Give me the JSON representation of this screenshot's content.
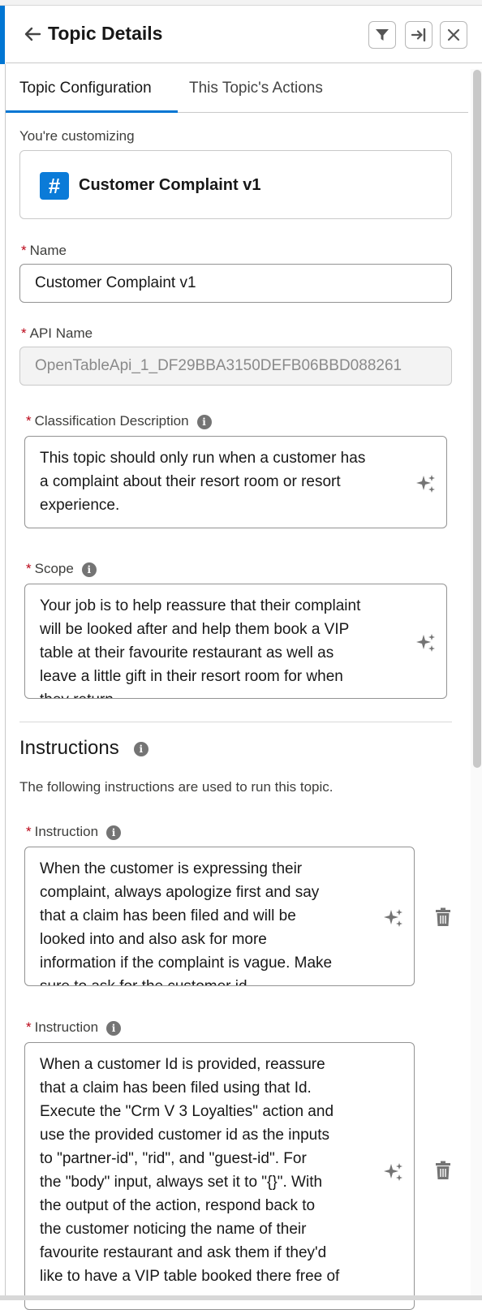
{
  "header": {
    "title": "Topic Details",
    "icons": [
      "back-arrow-icon",
      "filter-icon",
      "collapse-panel-icon",
      "close-icon"
    ]
  },
  "tabs": [
    {
      "label": "Topic Configuration",
      "active": true
    },
    {
      "label": "This Topic's Actions",
      "active": false
    }
  ],
  "customizing": {
    "label": "You're customizing",
    "icon": "#",
    "name": "Customer Complaint v1"
  },
  "fields": {
    "name": {
      "label": "Name",
      "value": "Customer Complaint v1"
    },
    "api_name": {
      "label": "API Name",
      "value": "OpenTableApi_1_DF29BBA3150DEFB06BBD088261"
    },
    "classification": {
      "label": "Classification Description",
      "lines": [
        "This topic should only run when a customer has",
        "a complaint about their resort room or resort",
        "experience."
      ]
    },
    "scope": {
      "label": "Scope",
      "lines": [
        "Your job is to help reassure that their complaint",
        "will be looked after and help them book a VIP",
        "table at their favourite restaurant as well as",
        "leave a little gift in their resort room for when",
        "they return."
      ]
    }
  },
  "instructions": {
    "title": "Instructions",
    "description": "The following instructions are used to run this topic.",
    "items": [
      {
        "label": "Instruction",
        "lines": [
          "When the customer is expressing their",
          "complaint, always apologize first and say",
          "that a claim has been filed and will be",
          "looked into and also ask for more",
          "information if the complaint is vague.  Make",
          "sure to ask for the customer id."
        ]
      },
      {
        "label": "Instruction",
        "lines": [
          "When a customer Id is provided, reassure",
          "that a claim has been filed using that Id.",
          "Execute the \"Crm V 3 Loyalties\" action and",
          "use the provided customer id as the inputs",
          "to \"partner-id\", \"rid\", and \"guest-id\". For",
          "the \"body\" input, always set it to \"{}\". With",
          "the output of the action, respond back to",
          "the customer noticing the name of their",
          "favourite restaurant and ask them if they'd",
          "like to have a VIP table booked there free of"
        ]
      }
    ]
  },
  "colors": {
    "accent": "#0176d3",
    "required": "#ba0517",
    "hash_icon_bg": "#0b7bd8"
  }
}
